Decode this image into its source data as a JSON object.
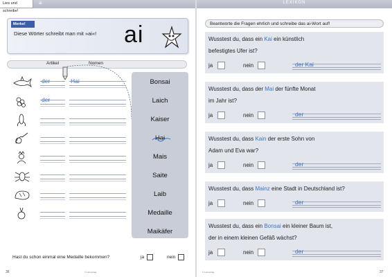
{
  "left": {
    "header_tab": "Lies und schreibe!",
    "header_ai": "ai",
    "merke_label": "Merke!",
    "merke_text": "Diese Wörter schreibt man mit »ai«!",
    "big_ai": "ai",
    "col_artikel": "Artikel",
    "col_nomen": "Nomen",
    "rows": [
      {
        "icon": "shark-icon",
        "artikel": "der",
        "nomen": "Hai"
      },
      {
        "icon": "frogspawn-icon",
        "artikel": "der",
        "nomen": ""
      },
      {
        "icon": "corn-icon",
        "artikel": "",
        "nomen": ""
      },
      {
        "icon": "violin-icon",
        "artikel": "",
        "nomen": ""
      },
      {
        "icon": "emperor-icon",
        "artikel": "",
        "nomen": ""
      },
      {
        "icon": "maybug-icon",
        "artikel": "",
        "nomen": ""
      },
      {
        "icon": "bread-loaf-icon",
        "artikel": "",
        "nomen": ""
      },
      {
        "icon": "medal-icon",
        "artikel": "",
        "nomen": ""
      }
    ],
    "words": [
      "Bonsai",
      "Laich",
      "Kaiser",
      "Hai",
      "Mais",
      "Saite",
      "Laib",
      "Medaille",
      "Maikäfer"
    ],
    "question": "Hast du schon einmal eine Medaille bekommen?",
    "ja": "ja",
    "nein": "nein",
    "page_number": "36",
    "footer": "© Lernverlag"
  },
  "right": {
    "header": "LEXIKON",
    "instruction": "Beantworte die Fragen ehrlich und schreibe das ai-Wort auf!",
    "ja": "ja",
    "nein": "nein",
    "questions": [
      {
        "line1_pre": "Wusstest du, dass ein ",
        "line1_hl": "Kai",
        "line1_post": " ein künstlich",
        "line2": "befestigtes Ufer ist?",
        "answer": "der Kai"
      },
      {
        "line1_pre": "Wusstest du, dass der ",
        "line1_hl": "Mai",
        "line1_post": " der fünfte Monat",
        "line2": "im Jahr ist?",
        "answer": "der"
      },
      {
        "line1_pre": "Wusstest du, dass ",
        "line1_hl": "Kain",
        "line1_post": " der erste Sohn von",
        "line2": "Adam und Eva war?",
        "answer": "der"
      },
      {
        "line1_pre": "Wusstest du, dass ",
        "line1_hl": "Mainz",
        "line1_post": " eine Stadt in Deutschland ist?",
        "line2": "",
        "answer": "der"
      },
      {
        "line1_pre": "Wusstest du, dass ein ",
        "line1_hl": "Bonsai",
        "line1_post": " ein kleiner Baum ist,",
        "line2": "der in einem kleinen Gefäß wächst?",
        "answer": "der"
      }
    ],
    "page_number": "37",
    "footer": "© Lernverlag"
  }
}
